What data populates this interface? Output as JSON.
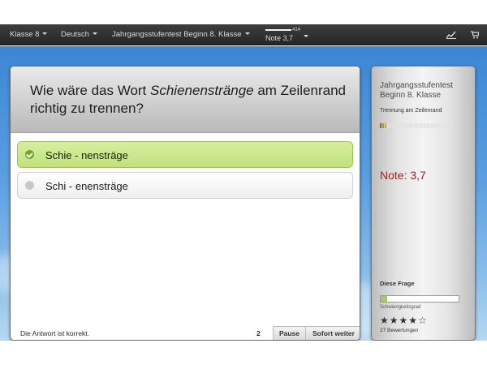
{
  "navbar": {
    "class_menu": "Klasse 8",
    "subject_menu": "Deutsch",
    "test_menu": "Jahrgangsstufentest Beginn 8. Klasse",
    "note_count": "414",
    "note_label": "Note 3,7",
    "icons": [
      "chart-icon",
      "cart-icon"
    ]
  },
  "quiz": {
    "question_prefix": "Wie wäre das Wort ",
    "question_word": "Schienenstränge",
    "question_suffix": " am Zeilenrand richtig zu trennen?",
    "answers": [
      {
        "label": "Schie - nensträge",
        "state": "correct"
      },
      {
        "label": "Schi - enensträge",
        "state": "unselected"
      }
    ],
    "feedback": "Die Antwort ist korrekt.",
    "question_number": "2",
    "pause_label": "Pause",
    "next_label": "Sofort weiter"
  },
  "sidebar": {
    "title": "Jahrgangsstufentest Beginn 8. Klasse",
    "subtitle": "Trennung am Zeilenrand",
    "progress_cells": 30,
    "progress_colors": [
      "#c8423a",
      "#7da83a",
      "#e0a236"
    ],
    "grade": "Note: 3,7",
    "difficulty_label": "Diese Frage",
    "difficulty_fraction": 0.08,
    "difficulty_caption": "Schwierigkeitsgrad",
    "stars_filled": 4,
    "stars_total": 5,
    "ratings": "27 Bewertungen"
  },
  "colors": {
    "correct_bg": "#c8e78a",
    "grade": "#a22222",
    "navbar": "#2f2f2f"
  }
}
